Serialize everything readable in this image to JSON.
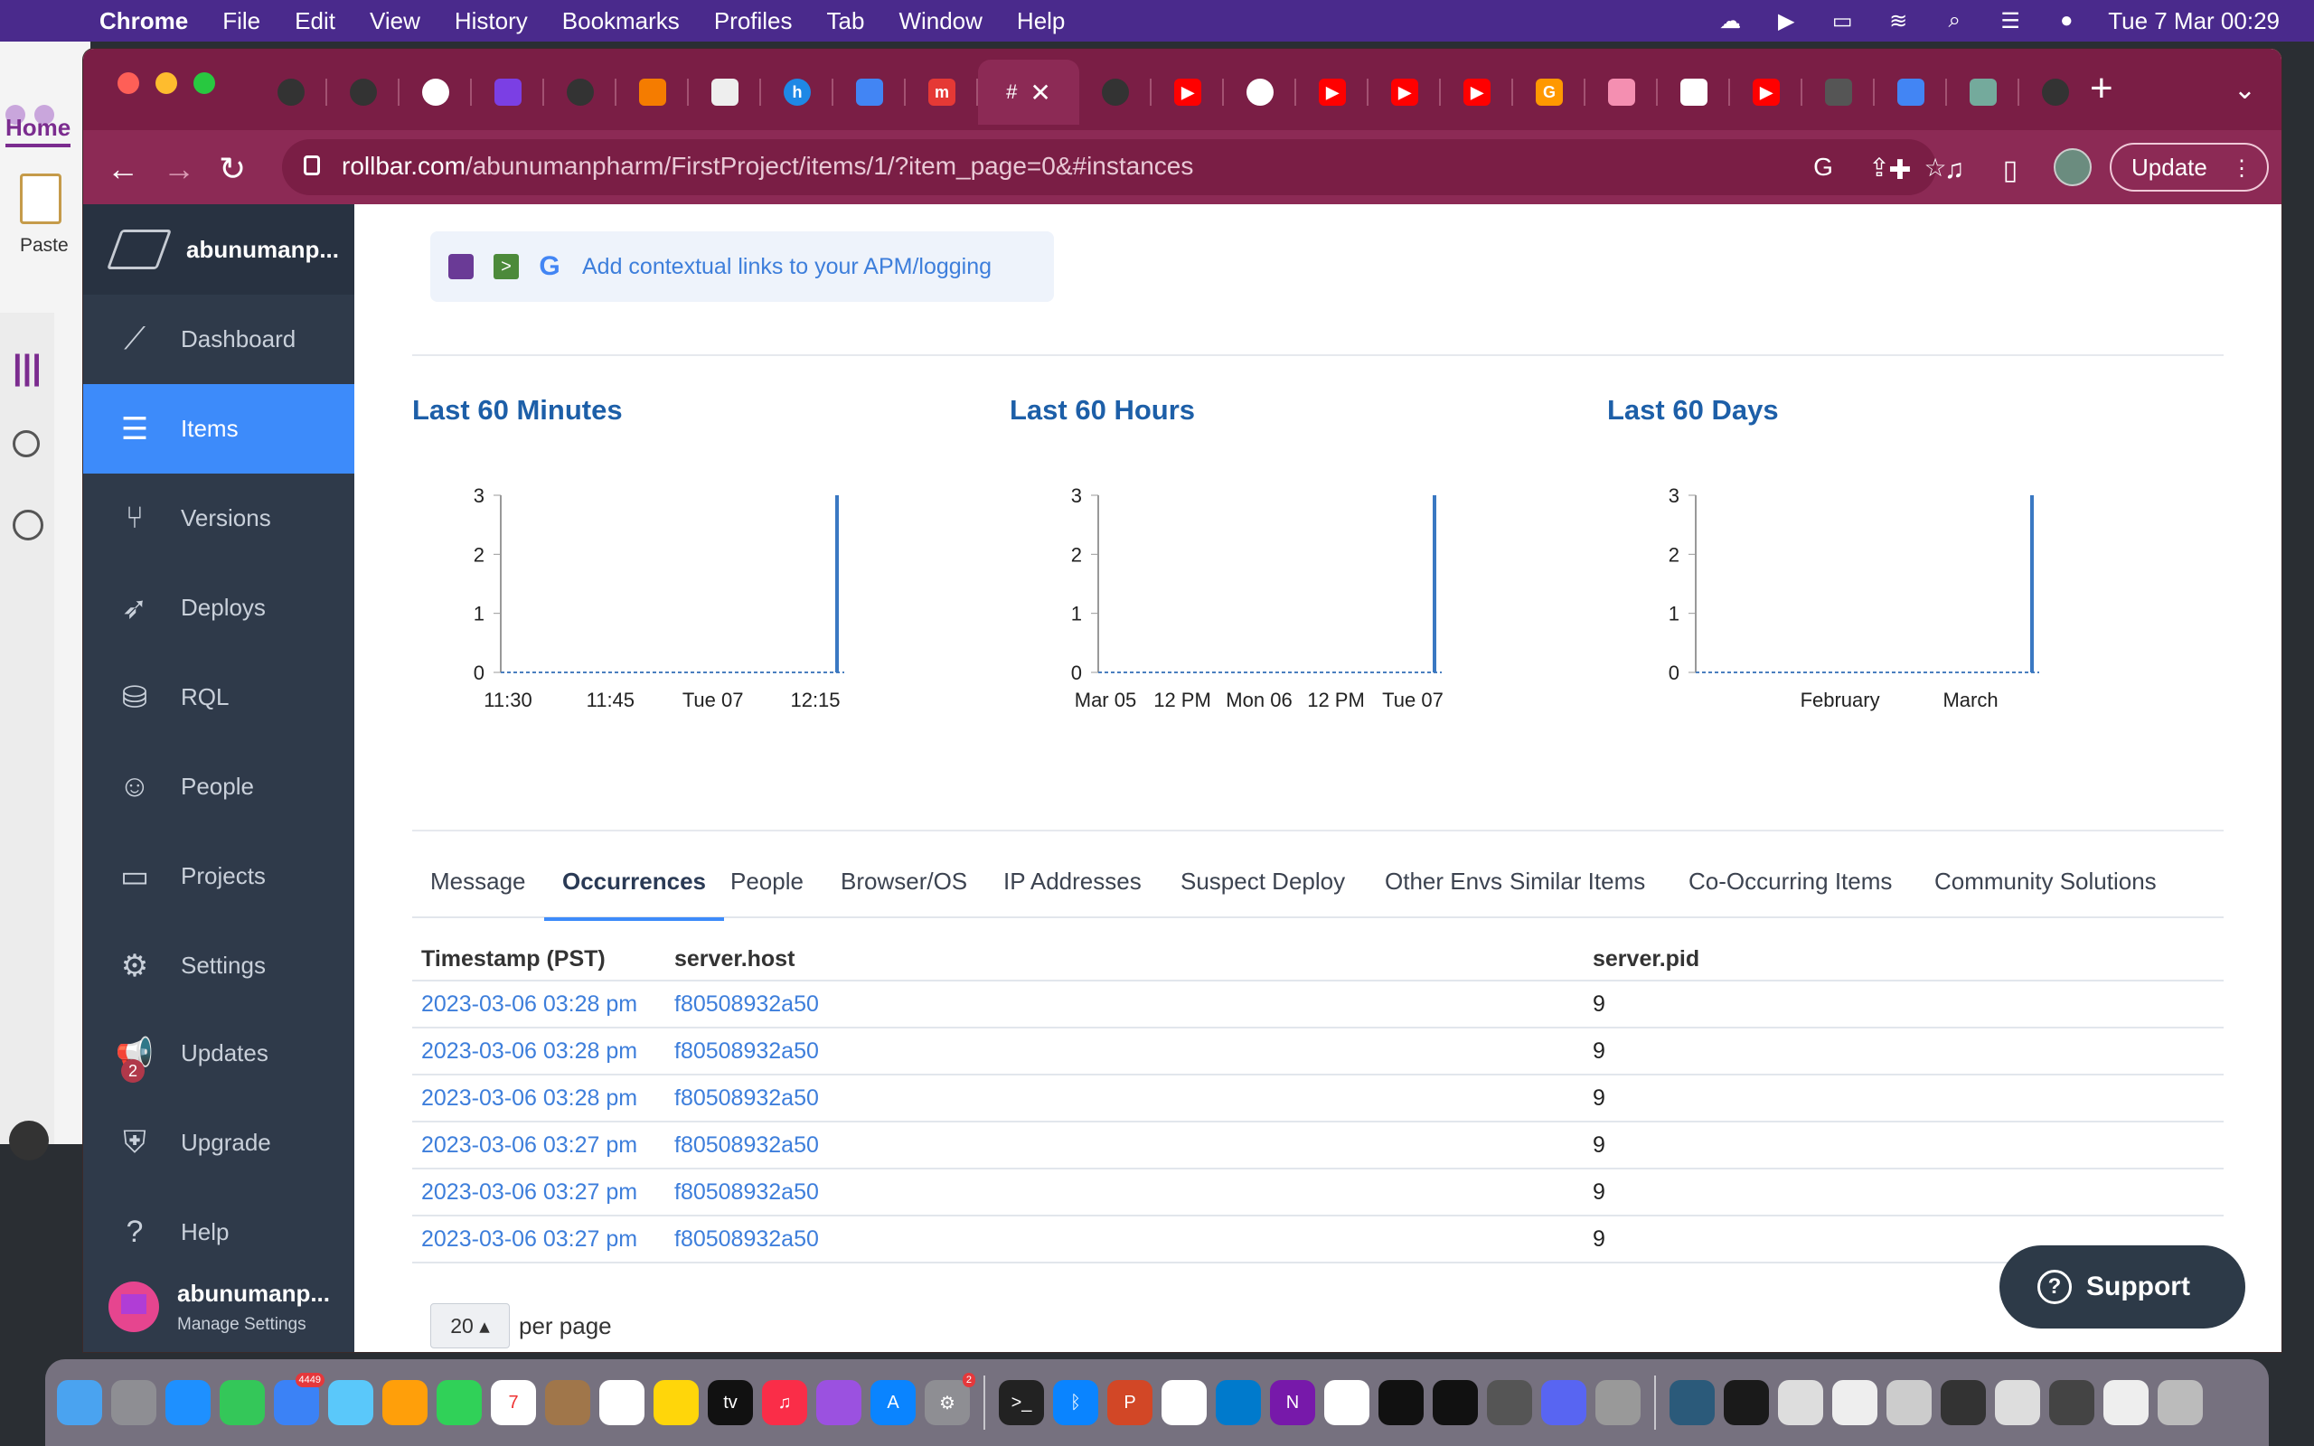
{
  "menubar": {
    "app": "Chrome",
    "items": [
      "File",
      "Edit",
      "View",
      "History",
      "Bookmarks",
      "Profiles",
      "Tab",
      "Window",
      "Help"
    ],
    "datetime": "Tue 7 Mar  00:29"
  },
  "bg_app": {
    "home_tab": "Home",
    "paste_label": "Paste"
  },
  "browser": {
    "url_host": "rollbar.com",
    "url_path": "/abunumanpharm/FirstProject/items/1/?item_page=0&#instances",
    "update_label": "Update",
    "tab_active_label": "#"
  },
  "sidebar": {
    "org_name": "abunumanp...",
    "items": [
      {
        "label": "Dashboard",
        "icon": "chart-line-icon"
      },
      {
        "label": "Items",
        "icon": "list-icon"
      },
      {
        "label": "Versions",
        "icon": "branch-icon"
      },
      {
        "label": "Deploys",
        "icon": "rocket-icon"
      },
      {
        "label": "RQL",
        "icon": "database-search-icon"
      },
      {
        "label": "People",
        "icon": "people-icon"
      },
      {
        "label": "Projects",
        "icon": "folder-gear-icon"
      },
      {
        "label": "Settings",
        "icon": "gear-icon"
      },
      {
        "label": "Updates",
        "icon": "megaphone-icon"
      },
      {
        "label": "Upgrade",
        "icon": "shield-icon"
      },
      {
        "label": "Help",
        "icon": "help-icon"
      }
    ],
    "active": "Items",
    "updates_badge": "2",
    "user_name": "abunumanp...",
    "manage_settings": "Manage Settings"
  },
  "main": {
    "context_link": "Add contextual links to your APM/logging",
    "tabs": [
      "Message",
      "Occurrences",
      "People",
      "Browser/OS",
      "IP Addresses",
      "Suspect Deploy",
      "Other Envs",
      "Similar Items",
      "Co-Occurring Items",
      "Community Solutions"
    ],
    "active_tab": "Occurrences",
    "table": {
      "headers": [
        "Timestamp (PST)",
        "server.host",
        "server.pid"
      ],
      "rows": [
        [
          "2023-03-06 03:28 pm",
          "f80508932a50",
          "9"
        ],
        [
          "2023-03-06 03:28 pm",
          "f80508932a50",
          "9"
        ],
        [
          "2023-03-06 03:28 pm",
          "f80508932a50",
          "9"
        ],
        [
          "2023-03-06 03:27 pm",
          "f80508932a50",
          "9"
        ],
        [
          "2023-03-06 03:27 pm",
          "f80508932a50",
          "9"
        ],
        [
          "2023-03-06 03:27 pm",
          "f80508932a50",
          "9"
        ]
      ]
    },
    "pager": {
      "per_page_value": "20",
      "per_page_label": "per page"
    },
    "support_label": "Support"
  },
  "chart_data": [
    {
      "type": "bar",
      "title": "Last 60 Minutes",
      "x_ticks": [
        "11:30",
        "11:45",
        "Tue 07",
        "12:15"
      ],
      "y_ticks": [
        "0",
        "1",
        "2",
        "3"
      ],
      "ylim": [
        0,
        3
      ],
      "values_note_last_bucket": 3
    },
    {
      "type": "bar",
      "title": "Last 60 Hours",
      "x_ticks": [
        "Mar 05",
        "12 PM",
        "Mon 06",
        "12 PM",
        "Tue 07"
      ],
      "y_ticks": [
        "0",
        "1",
        "2",
        "3"
      ],
      "ylim": [
        0,
        3
      ],
      "values_note_last_bucket": 3
    },
    {
      "type": "bar",
      "title": "Last 60 Days",
      "x_ticks": [
        "February",
        "March"
      ],
      "y_ticks": [
        "0",
        "1",
        "2",
        "3"
      ],
      "ylim": [
        0,
        3
      ],
      "values_note_last_bucket": 3
    }
  ],
  "colors": {
    "sidebar_bg": "#2f3a4a",
    "active_nav": "#3d8bfa",
    "link": "#3d7edb",
    "chart_title": "#1d5fa8",
    "tab_strip": "#7a1e45"
  }
}
